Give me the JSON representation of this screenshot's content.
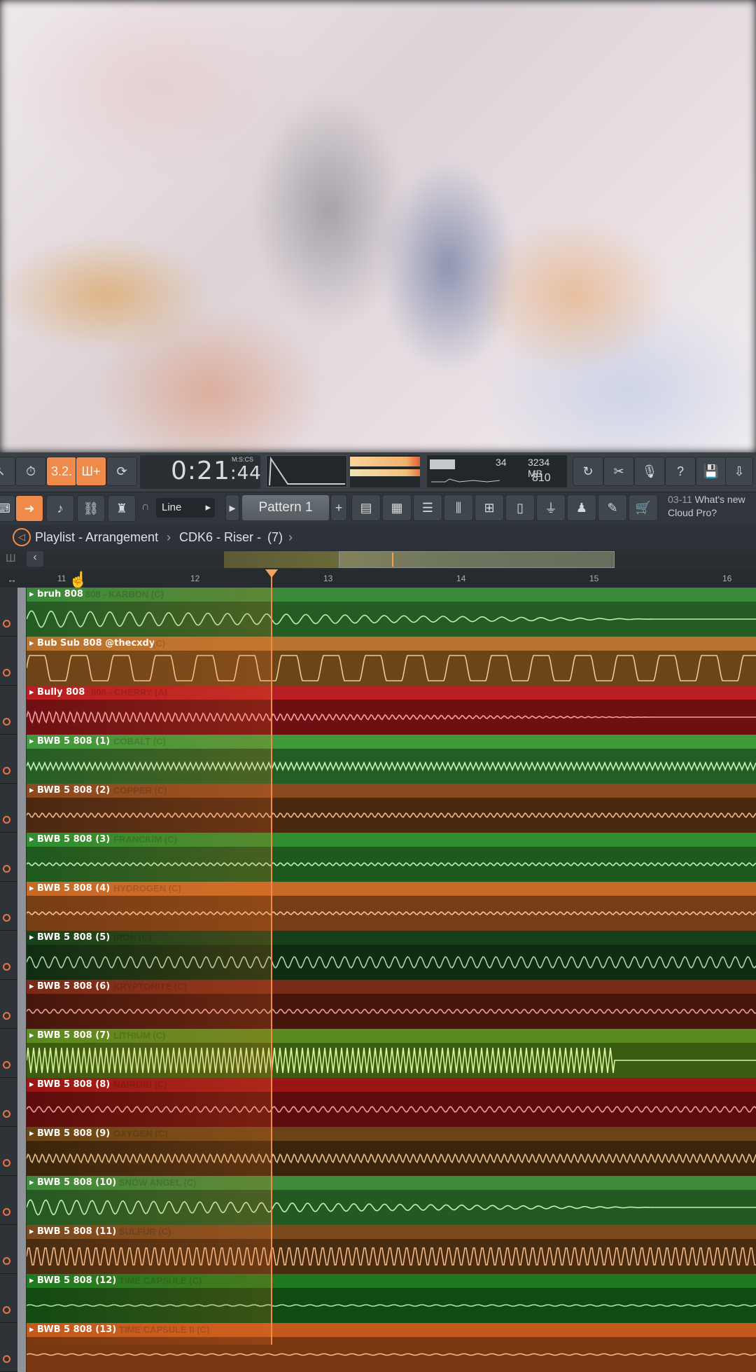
{
  "toolbar": {
    "time": "0:21",
    "time_cs": "44",
    "time_format": "M:S:CS",
    "cpu_value": "34",
    "memory": "3234 MB",
    "polyphony": "810",
    "snap_mode": "Line",
    "pattern": "Pattern 1",
    "news_date": "03-11",
    "news_text": "What's new",
    "news_text2": "Cloud Pro?",
    "rec_label": "3.2.",
    "snap_label": "Ш+"
  },
  "playlist": {
    "title": "Playlist - Arrangement",
    "crumb": "CDK6 - Riser -",
    "count": "(7)"
  },
  "ruler": [
    "11",
    "12",
    "13",
    "14",
    "15",
    "16"
  ],
  "tracks": [
    {
      "label": "bruh 808",
      "ghost": "808 - KARBON (C)",
      "hdr": "#3a8a3a",
      "body": "#245c24",
      "wave": "#b8f0b0"
    },
    {
      "label": "Bub Sub 808 @thecxdy",
      "ghost": "(C)",
      "hdr": "#b8742e",
      "body": "#6b4418",
      "wave": "#f3c792"
    },
    {
      "label": "Bully 808",
      "ghost": "808 - CHERRY (A)",
      "hdr": "#b81e22",
      "body": "#6e0f12",
      "wave": "#f2a0a4"
    },
    {
      "label": "BWB 5 808 (1)",
      "ghost": "COBALT (C)",
      "hdr": "#3f9a3c",
      "body": "#255e24",
      "wave": "#c6f5bd"
    },
    {
      "label": "BWB 5 808 (2)",
      "ghost": "COPPER (C)",
      "hdr": "#8a4a20",
      "body": "#4b2810",
      "wave": "#e9b693"
    },
    {
      "label": "BWB 5 808 (3)",
      "ghost": "FRANCIUM (C)",
      "hdr": "#2f8e2f",
      "body": "#1e5a1e",
      "wave": "#bff0ba"
    },
    {
      "label": "BWB 5 808 (4)",
      "ghost": "HYDROGEN (C)",
      "hdr": "#c66a28",
      "body": "#773d14",
      "wave": "#f5c39a"
    },
    {
      "label": "BWB 5 808 (5)",
      "ghost": "IRON (C)",
      "hdr": "#17401a",
      "body": "#0f2d12",
      "wave": "#a3d8a5"
    },
    {
      "label": "BWB 5 808 (6)",
      "ghost": "KRYPTONITE (C)",
      "hdr": "#7a2a18",
      "body": "#46160c",
      "wave": "#e9a295"
    },
    {
      "label": "BWB 5 808 (7)",
      "ghost": "LITHIUM (C)",
      "hdr": "#5a8a1e",
      "body": "#3a5c12",
      "wave": "#d8f59a"
    },
    {
      "label": "BWB 5 808 (8)",
      "ghost": "NAIROBI (C)",
      "hdr": "#9a1616",
      "body": "#5c0c0c",
      "wave": "#f0a0a0"
    },
    {
      "label": "BWB 5 808 (9)",
      "ghost": "OXYGEN (C)",
      "hdr": "#6a4416",
      "body": "#3a250c",
      "wave": "#e6c08c"
    },
    {
      "label": "BWB 5 808 (10)",
      "ghost": "SNOW ANGEL (C)",
      "hdr": "#3e8a3a",
      "body": "#245a22",
      "wave": "#c2f0b8"
    },
    {
      "label": "BWB 5 808 (11)",
      "ghost": "SULFUR (C)",
      "hdr": "#7a4a1e",
      "body": "#4a2c10",
      "wave": "#f0b98a"
    },
    {
      "label": "BWB 5 808 (12)",
      "ghost": "TIME CAPSULE (C)",
      "hdr": "#1f7a1f",
      "body": "#114a12",
      "wave": "#b0e8a8"
    },
    {
      "label": "BWB 5 808 (13)",
      "ghost": "TIME CAPSULE II (C)",
      "hdr": "#c25a1e",
      "body": "#7a3812",
      "wave": "#f5b888"
    }
  ],
  "colors": {
    "accent": "#f08a4b",
    "playhead": "#f08a4b"
  }
}
